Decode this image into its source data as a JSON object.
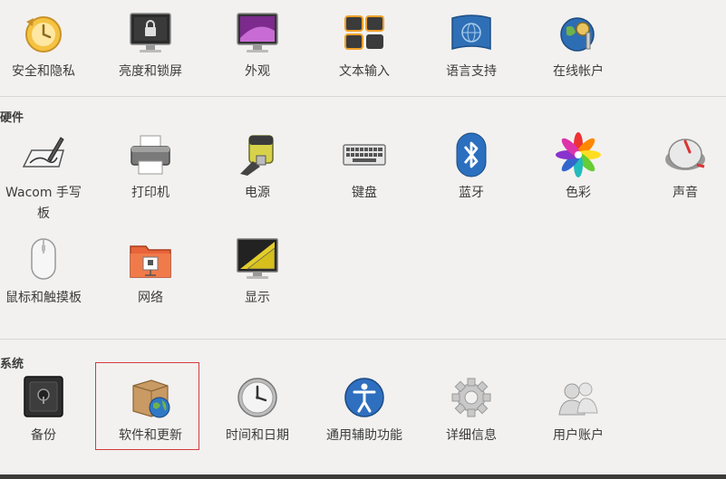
{
  "personal": {
    "items": [
      {
        "label": "安全和隐私",
        "icon": "privacy-icon"
      },
      {
        "label": "亮度和锁屏",
        "icon": "lock-screen-icon"
      },
      {
        "label": "外观",
        "icon": "appearance-icon"
      },
      {
        "label": "文本输入",
        "icon": "keyboard-input-icon"
      },
      {
        "label": "语言支持",
        "icon": "language-icon"
      },
      {
        "label": "在线帐户",
        "icon": "online-accounts-icon"
      }
    ]
  },
  "hardware": {
    "title": "硬件",
    "items": [
      {
        "label": "Wacom 手写板",
        "icon": "wacom-tablet-icon"
      },
      {
        "label": "打印机",
        "icon": "printer-icon"
      },
      {
        "label": "电源",
        "icon": "power-icon"
      },
      {
        "label": "键盘",
        "icon": "keyboard-icon"
      },
      {
        "label": "蓝牙",
        "icon": "bluetooth-icon"
      },
      {
        "label": "色彩",
        "icon": "color-icon"
      },
      {
        "label": "声音",
        "icon": "sound-icon"
      },
      {
        "label": "鼠标和触摸板",
        "icon": "mouse-icon"
      },
      {
        "label": "网络",
        "icon": "network-icon"
      },
      {
        "label": "显示",
        "icon": "display-icon"
      }
    ]
  },
  "system": {
    "title": "系统",
    "items": [
      {
        "label": "备份",
        "icon": "backup-icon"
      },
      {
        "label": "软件和更新",
        "icon": "software-updates-icon"
      },
      {
        "label": "时间和日期",
        "icon": "clock-icon"
      },
      {
        "label": "通用辅助功能",
        "icon": "accessibility-icon"
      },
      {
        "label": "详细信息",
        "icon": "details-gear-icon"
      },
      {
        "label": "用户账户",
        "icon": "user-accounts-icon"
      }
    ]
  },
  "colors": {
    "selection_border": "#d63a3a",
    "background": "#f2f1f0"
  }
}
